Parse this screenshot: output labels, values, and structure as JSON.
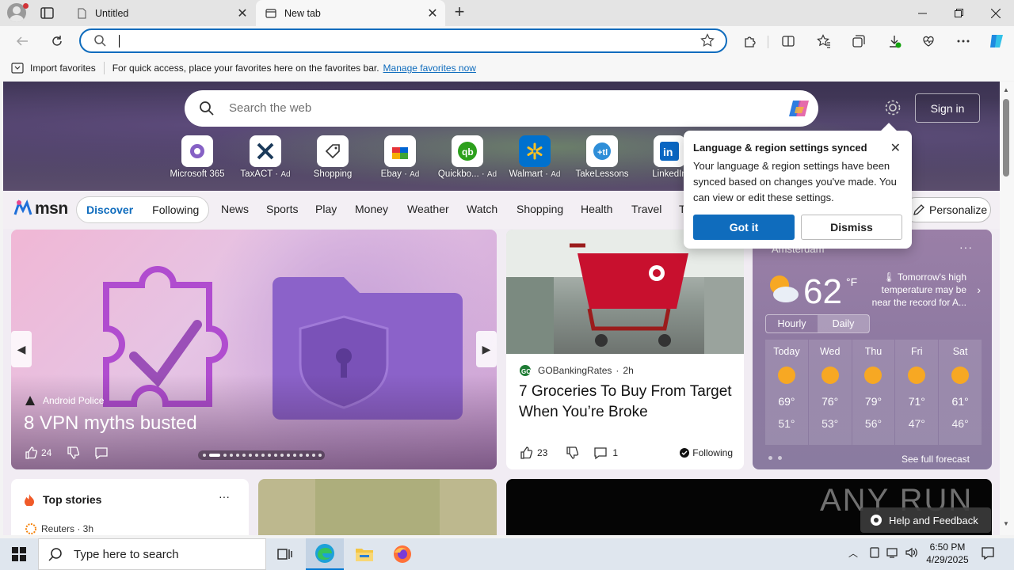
{
  "browser": {
    "tabs": [
      {
        "title": "Untitled",
        "active": false
      },
      {
        "title": "New tab",
        "active": true
      }
    ],
    "address": {
      "value": "",
      "placeholder": ""
    },
    "favorites_bar": {
      "import_label": "Import favorites",
      "hint": "For quick access, place your favorites here on the favorites bar.",
      "manage_link": "Manage favorites now"
    }
  },
  "newtab": {
    "search_placeholder": "Search the web",
    "signin_label": "Sign in",
    "quick_links": [
      {
        "label": "Microsoft 365",
        "ad": ""
      },
      {
        "label": "TaxACT",
        "ad": "Ad"
      },
      {
        "label": "Shopping",
        "ad": ""
      },
      {
        "label": "Ebay",
        "ad": "Ad"
      },
      {
        "label": "Quickbo...",
        "ad": "Ad"
      },
      {
        "label": "Walmart",
        "ad": "Ad"
      },
      {
        "label": "TakeLessons",
        "ad": ""
      },
      {
        "label": "LinkedIn",
        "ad": ""
      }
    ],
    "msn_logo": "msn",
    "feed_tabs": {
      "discover": "Discover",
      "following": "Following"
    },
    "nav_items": [
      "News",
      "Sports",
      "Play",
      "Money",
      "Weather",
      "Watch",
      "Shopping",
      "Health",
      "Travel",
      "T"
    ],
    "personalize_label": "Personalize"
  },
  "hero_card": {
    "source": "Android Police",
    "headline": "8 VPN myths busted",
    "likes": "24",
    "total_slides": 18,
    "active_slide": 2
  },
  "news_card": {
    "source": "GOBankingRates",
    "age": "2h",
    "title": "7 Groceries To Buy From Target When You’re Broke",
    "likes": "23",
    "comments": "1",
    "following_label": "Following"
  },
  "weather": {
    "location": "Amsterdam",
    "temp": "62",
    "unit": "°F",
    "alert": "Tomorrow's high temperature may be near the record for A...",
    "toggle": {
      "hourly": "Hourly",
      "daily": "Daily"
    },
    "days": [
      {
        "day": "Today",
        "hi": "69°",
        "lo": "51°",
        "icon": "partly-sunny"
      },
      {
        "day": "Wed",
        "hi": "76°",
        "lo": "53°",
        "icon": "sunny"
      },
      {
        "day": "Thu",
        "hi": "79°",
        "lo": "56°",
        "icon": "sunny"
      },
      {
        "day": "Fri",
        "hi": "71°",
        "lo": "47°",
        "icon": "partly-sunny"
      },
      {
        "day": "Sat",
        "hi": "61°",
        "lo": "46°",
        "icon": "partly-sunny"
      }
    ],
    "see_full": "See full forecast"
  },
  "top_stories": {
    "title": "Top stories",
    "first_source": "Reuters · 3h"
  },
  "popup": {
    "title": "Language & region settings synced",
    "body": "Your language & region settings have been synced based on changes you've made. You can view or edit these settings.",
    "primary": "Got it",
    "secondary": "Dismiss"
  },
  "help_button": "Help and Feedback",
  "watermark": "ANY RUN",
  "taskbar": {
    "search_placeholder": "Type here to search",
    "time": "6:50 PM",
    "date": "4/29/2025"
  },
  "colors": {
    "accent": "#0f6cbd",
    "taskbar": "#dfe6ee"
  }
}
